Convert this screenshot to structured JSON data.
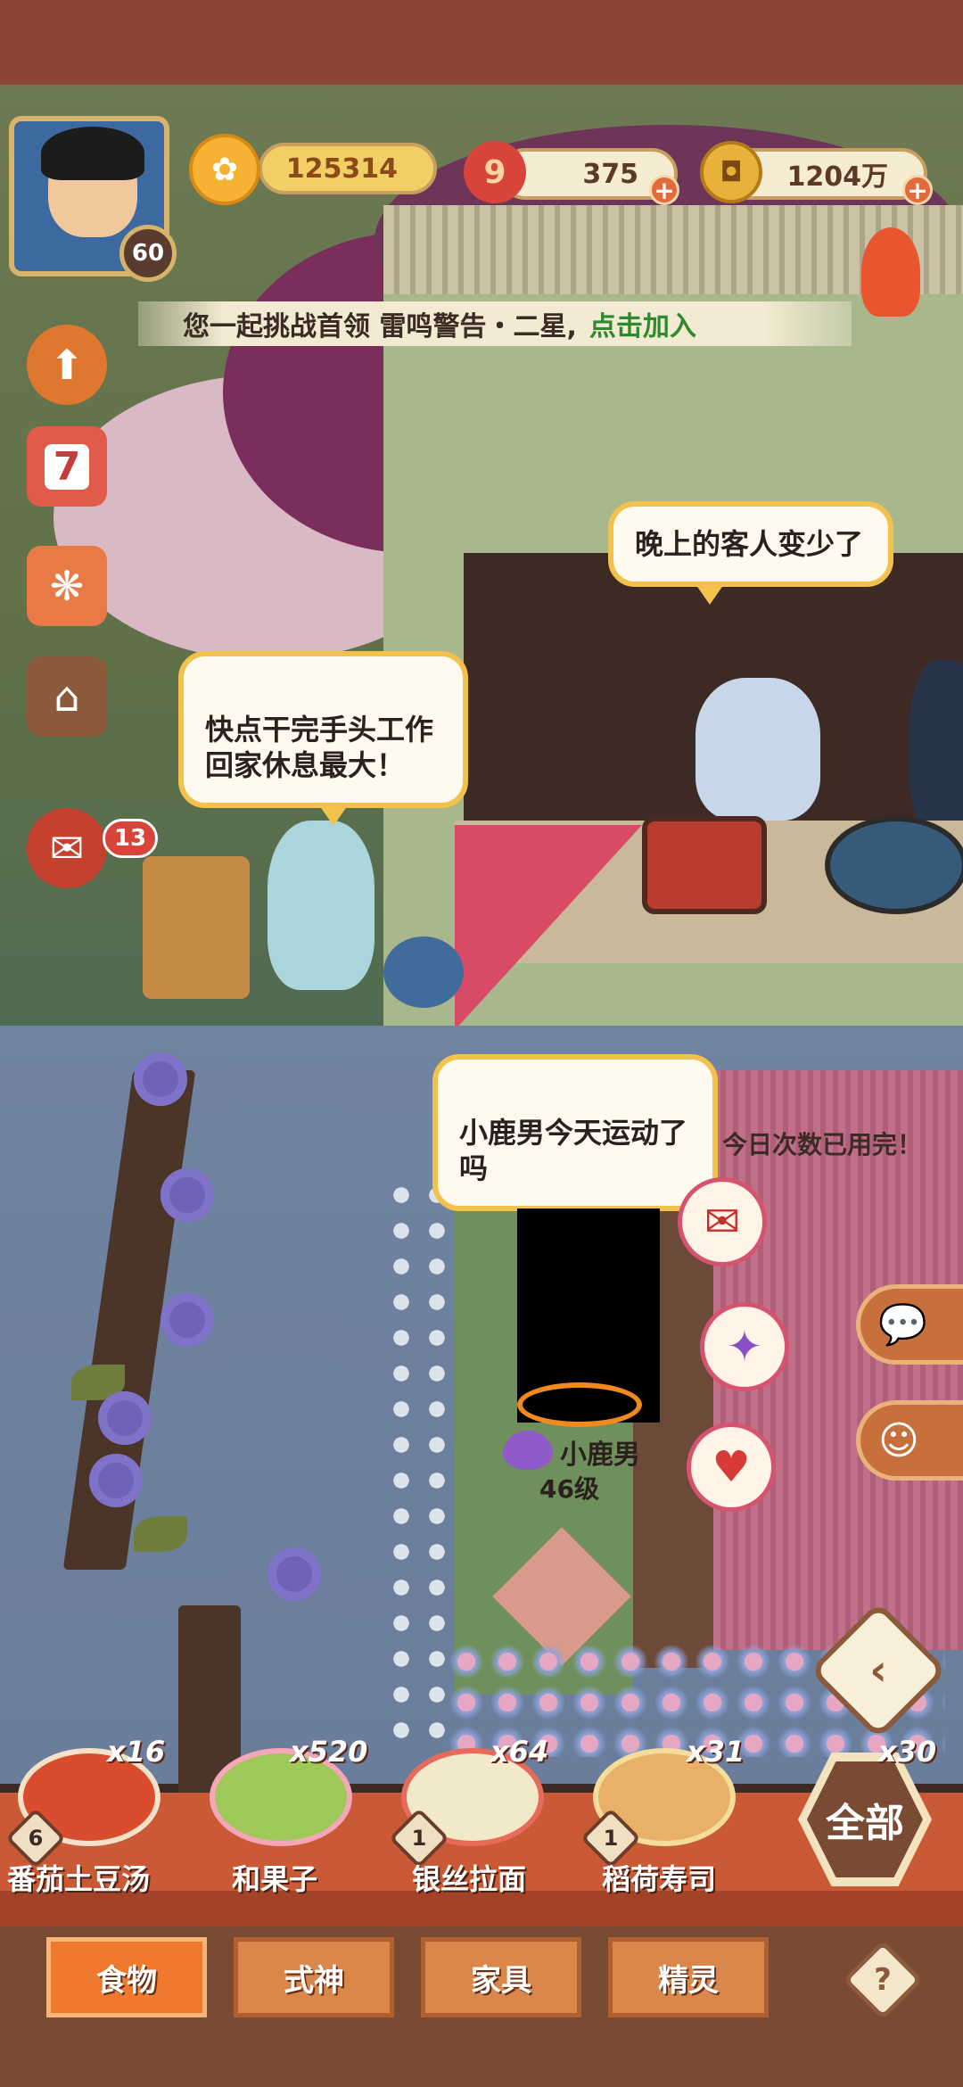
{
  "player": {
    "level": "60"
  },
  "resources": {
    "jade": "125314",
    "stamina": "375",
    "coins": "1204万"
  },
  "marquee": {
    "text": "您一起挑战首领 雷鸣警告・二星,",
    "link": "点击加入"
  },
  "side": {
    "calendar_day": "7",
    "notifications": "13"
  },
  "bubbles": {
    "left": "快点干完手头工作\n回家休息最大！",
    "right": "晚上的客人变少了",
    "npc": "小鹿男今天运动了\n吗"
  },
  "status_text": "今日次数已用完！",
  "npc": {
    "name": "小鹿男",
    "level": "46级"
  },
  "foods": [
    {
      "name": "番茄土豆汤",
      "count": "x16",
      "level": "6"
    },
    {
      "name": "和果子",
      "count": "x520",
      "level": ""
    },
    {
      "name": "银丝拉面",
      "count": "x64",
      "level": "1"
    },
    {
      "name": "稻荷寿司",
      "count": "x31",
      "level": "1"
    }
  ],
  "all_button": {
    "label": "全部",
    "count": "x30"
  },
  "tabs": [
    "食物",
    "式神",
    "家具",
    "精灵"
  ],
  "help": "?",
  "icons": {
    "jade": "chrysanthemum-icon",
    "stamina": "nine-icon",
    "coins": "coin-icon",
    "upgrade": "arrow-up-icon",
    "chat": "chat-icon"
  },
  "colors": {
    "accent": "#ef7a2e",
    "bubble_border": "#f3c24d",
    "link": "#2f8a2f"
  }
}
